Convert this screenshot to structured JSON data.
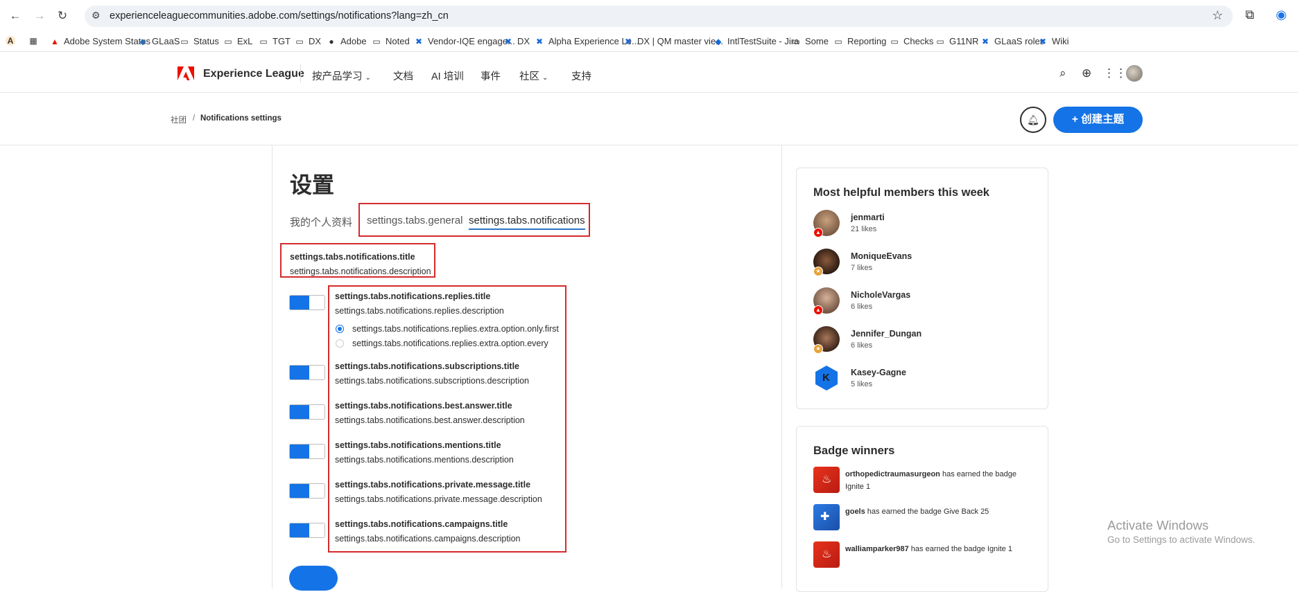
{
  "browser": {
    "url": "experienceleaguecommunities.adobe.com/settings/notifications?lang=zh_cn",
    "back_glyph": "←",
    "forward_glyph": "→",
    "reload_glyph": "↻",
    "icons": [
      "back-icon",
      "forward-icon",
      "reload-icon",
      "tune-icon",
      "star-icon",
      "extensions-icon",
      "profile-icon"
    ]
  },
  "bookmarks": [
    {
      "label": "A",
      "icon": "profile-icon"
    },
    {
      "label": "",
      "icon": "apps-grid-icon"
    },
    {
      "label": "Adobe System Status",
      "icon": "adobe-icon"
    },
    {
      "label": "GLaaS",
      "icon": "globe-icon"
    },
    {
      "label": "Status",
      "icon": "folder-icon"
    },
    {
      "label": "ExL",
      "icon": "folder-icon"
    },
    {
      "label": "TGT",
      "icon": "folder-icon"
    },
    {
      "label": "DX",
      "icon": "folder-icon"
    },
    {
      "label": "Adobe",
      "icon": "github-icon"
    },
    {
      "label": "Noted",
      "icon": "folder-icon"
    },
    {
      "label": "Vendor-IQE engage...",
      "icon": "confluence-icon"
    },
    {
      "label": "DX",
      "icon": "confluence-icon"
    },
    {
      "label": "Alpha Experience Le...",
      "icon": "confluence-icon"
    },
    {
      "label": "DX | QM master vie...",
      "icon": "confluence-icon"
    },
    {
      "label": "IntlTestSuite - Jira",
      "icon": "jira-icon"
    },
    {
      "label": "Some",
      "icon": "folder-icon"
    },
    {
      "label": "Reporting",
      "icon": "folder-icon"
    },
    {
      "label": "Checks",
      "icon": "folder-icon"
    },
    {
      "label": "G11NR",
      "icon": "folder-icon"
    },
    {
      "label": "GLaaS roles",
      "icon": "confluence-icon"
    },
    {
      "label": "Wiki",
      "icon": "confluence-icon"
    }
  ],
  "header": {
    "brand": "Experience League",
    "nav": [
      "按产品学习",
      "文档",
      "AI 培训",
      "事件",
      "社区",
      "支持"
    ],
    "accent": "#1473e6",
    "logo_color": "#eb1000"
  },
  "breadcrumb": {
    "root": "社团",
    "separator": "/",
    "current": "Notifications settings"
  },
  "actions": {
    "create_label": "+ 创建主题"
  },
  "settings": {
    "page_title": "设置",
    "tabs": [
      "我的个人资料",
      "settings.tabs.general",
      "settings.tabs.notifications"
    ],
    "active_tab": "settings.tabs.notifications",
    "section_title": "settings.tabs.notifications.title",
    "section_desc": "settings.tabs.notifications.description",
    "items": [
      {
        "title": "settings.tabs.notifications.replies.title",
        "desc": "settings.tabs.notifications.replies.description",
        "enabled": true
      },
      {
        "title": "settings.tabs.notifications.subscriptions.title",
        "desc": "settings.tabs.notifications.subscriptions.description",
        "enabled": true
      },
      {
        "title": "settings.tabs.notifications.best.answer.title",
        "desc": "settings.tabs.notifications.best.answer.description",
        "enabled": true
      },
      {
        "title": "settings.tabs.notifications.mentions.title",
        "desc": "settings.tabs.notifications.mentions.description",
        "enabled": true
      },
      {
        "title": "settings.tabs.notifications.private.message.title",
        "desc": "settings.tabs.notifications.private.message.description",
        "enabled": true
      },
      {
        "title": "settings.tabs.notifications.campaigns.title",
        "desc": "settings.tabs.notifications.campaigns.description",
        "enabled": true
      }
    ],
    "reply_options": [
      {
        "label": "settings.tabs.notifications.replies.extra.option.only.first",
        "selected": true
      },
      {
        "label": "settings.tabs.notifications.replies.extra.option.every",
        "selected": false
      }
    ],
    "highlight_color": "#d32a2a"
  },
  "helpful": {
    "title": "Most helpful members this week",
    "members": [
      {
        "name": "jenmarti",
        "likes": "21 likes",
        "badge": "adobe"
      },
      {
        "name": "MoniqueEvans",
        "likes": "7 likes",
        "badge": "star"
      },
      {
        "name": "NicholeVargas",
        "likes": "6 likes",
        "badge": "adobe"
      },
      {
        "name": "Jennifer_Dungan",
        "likes": "6 likes",
        "badge": "star"
      },
      {
        "name": "Kasey-Gagne",
        "likes": "5 likes",
        "badge": "none",
        "initial": "K"
      }
    ]
  },
  "badges": {
    "title": "Badge winners",
    "winners": [
      {
        "user": "orthopedictraumasurgeon",
        "text": " has earned the badge Ignite 1",
        "icon": "ignite-badge-icon"
      },
      {
        "user": "goels",
        "text": " has earned the badge Give Back 25",
        "icon": "give-back-badge-icon"
      },
      {
        "user": "walliamparker987",
        "text": " has earned the badge Ignite 1",
        "icon": "ignite-badge-icon"
      }
    ]
  },
  "watermark": {
    "line1": "Activate Windows",
    "line2": "Go to Settings to activate Windows."
  }
}
